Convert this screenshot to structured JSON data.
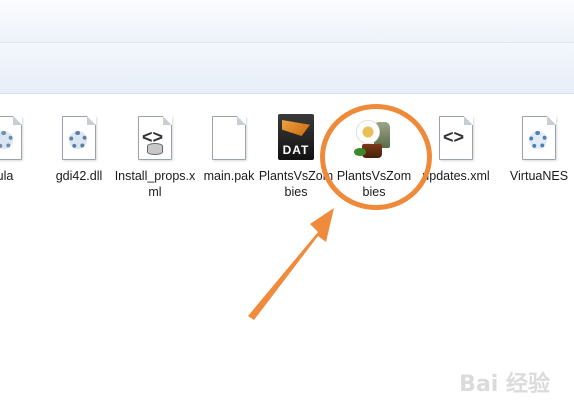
{
  "files": [
    {
      "name": "ula",
      "icon": "generic-file-icon"
    },
    {
      "name": "gdi42.dll",
      "icon": "dll-gear-icon"
    },
    {
      "name": "Install_props.xml",
      "icon": "xml-file-icon"
    },
    {
      "name": "main.pak",
      "icon": "blank-file-icon"
    },
    {
      "name": "PlantsVsZombies",
      "icon": "dat-file-icon",
      "badge": "DAT"
    },
    {
      "name": "PlantsVsZombies",
      "icon": "pvz-game-icon",
      "highlighted": true
    },
    {
      "name": "updates.xml",
      "icon": "xml-file-icon"
    },
    {
      "name": "VirtuaNES",
      "icon": "settings-gear-icon"
    }
  ],
  "annotation": {
    "ring_color": "#ef8a3a",
    "arrow_color": "#f08a3c"
  },
  "watermark": "Bai 经验"
}
